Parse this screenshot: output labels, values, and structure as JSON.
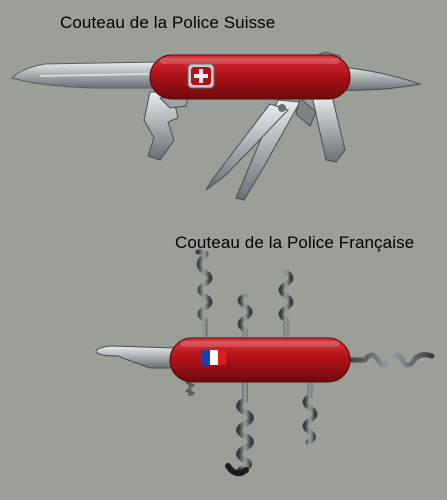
{
  "captions": {
    "swiss": "Couteau de la Police Suisse",
    "french": "Couteau de la Police Française"
  },
  "colors": {
    "background": "#9a9f98",
    "knife_red": "#b01218",
    "steel": "#b8bcc0",
    "steel_dark": "#5a5e62",
    "flag_blue": "#1a3fb0",
    "flag_white": "#ffffff",
    "flag_red": "#e01a1a"
  },
  "icons": {
    "swiss_emblem": "cross-shield-icon",
    "french_emblem": "french-flag-icon"
  }
}
